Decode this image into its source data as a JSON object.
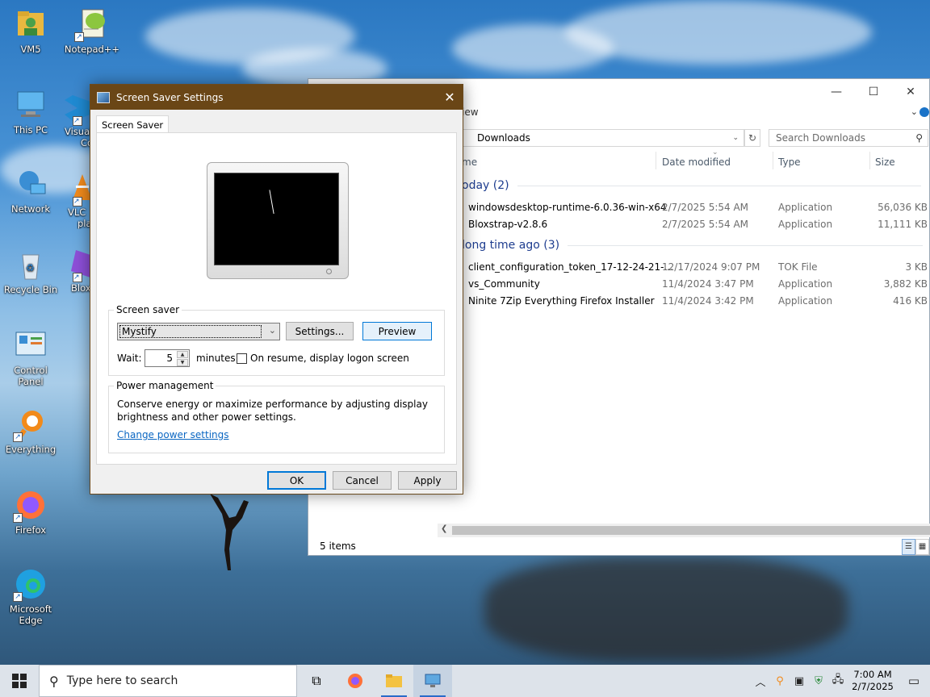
{
  "desktop": {
    "icons": [
      {
        "label": "VM5"
      },
      {
        "label": "Notepad++"
      },
      {
        "label": "This PC"
      },
      {
        "label": "Visual Studio Code",
        "partial": "Visua\nCo"
      },
      {
        "label": "Network"
      },
      {
        "label": "VLC media player",
        "partial": "VLC\npla"
      },
      {
        "label": "Recycle Bin"
      },
      {
        "label": "Bloxstrap",
        "partial": "Blox"
      },
      {
        "label": "Control Panel"
      },
      {
        "label": "Everything"
      },
      {
        "label": "Firefox"
      },
      {
        "label": "Microsoft Edge"
      }
    ],
    "vscode_partial": "Visual",
    "vscode_partial2": "Co",
    "vlc_partial": "VLC",
    "vlc_partial2": "pla",
    "blox_partial": "Blox",
    "edge_line1": "Microsoft",
    "edge_line2": "Edge"
  },
  "explorer": {
    "ribbon_partial": "iew",
    "address": "Downloads",
    "search_placeholder": "Search Downloads",
    "columns": {
      "name": "me",
      "date": "Date modified",
      "type": "Type",
      "size": "Size"
    },
    "groups": [
      {
        "label": "oday (2)"
      },
      {
        "label": "long time ago (3)"
      }
    ],
    "files": [
      {
        "name": "windowsdesktop-runtime-6.0.36-win-x64",
        "date": "2/7/2025 5:54 AM",
        "type": "Application",
        "size": "56,036 KB"
      },
      {
        "name": "Bloxstrap-v2.8.6",
        "date": "2/7/2025 5:54 AM",
        "type": "Application",
        "size": "11,111 KB"
      },
      {
        "name": "client_configuration_token_17-12-24-21-...",
        "date": "12/17/2024 9:07 PM",
        "type": "TOK File",
        "size": "3 KB"
      },
      {
        "name": "vs_Community",
        "date": "11/4/2024 3:47 PM",
        "type": "Application",
        "size": "3,882 KB"
      },
      {
        "name": "Ninite 7Zip Everything Firefox Installer",
        "date": "11/4/2024 3:42 PM",
        "type": "Application",
        "size": "416 KB"
      }
    ],
    "status": "5 items"
  },
  "dialog": {
    "title": "Screen Saver Settings",
    "tab": "Screen Saver",
    "screensaver_group": "Screen saver",
    "screensaver_value": "Mystify",
    "settings_btn": "Settings...",
    "preview_btn": "Preview",
    "wait_label": "Wait:",
    "wait_value": "5",
    "minutes_label": "minutes",
    "resume_label": "On resume, display logon screen",
    "resume_checked": false,
    "power_group": "Power management",
    "power_text1": "Conserve energy or maximize performance by adjusting display",
    "power_text2": "brightness and other power settings.",
    "power_link": "Change power settings",
    "ok_btn": "OK",
    "cancel_btn": "Cancel",
    "apply_btn": "Apply"
  },
  "taskbar": {
    "search_placeholder": "Type here to search",
    "time": "7:00 AM",
    "date": "2/7/2025"
  }
}
